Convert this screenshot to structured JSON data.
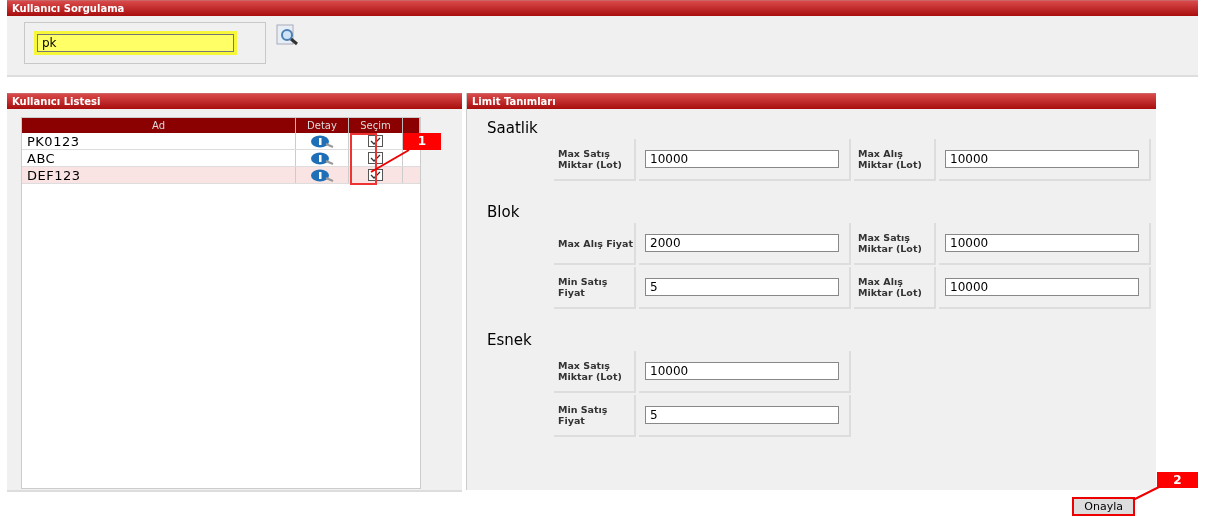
{
  "query_panel": {
    "title": "Kullanıcı Sorgulama",
    "search": {
      "value": "pk"
    }
  },
  "user_list": {
    "title": "Kullanıcı Listesi",
    "columns": [
      "Ad",
      "Detay",
      "Seçim"
    ],
    "rows": [
      {
        "name": "PK0123",
        "checked": true,
        "selected": false
      },
      {
        "name": "ABC",
        "checked": true,
        "selected": false
      },
      {
        "name": "DEF123",
        "checked": true,
        "selected": true
      }
    ]
  },
  "limits": {
    "title": "Limit Tanımları",
    "sections": [
      {
        "title": "Saatlik",
        "rows": [
          [
            {
              "label": "Max Satış Miktar (Lot)",
              "value": "10000"
            },
            {
              "label": "Max Alış Miktar (Lot)",
              "value": "10000"
            }
          ]
        ]
      },
      {
        "title": "Blok",
        "rows": [
          [
            {
              "label": "Max Alış Fiyat",
              "value": "2000"
            },
            {
              "label": "Max Satış Miktar (Lot)",
              "value": "10000"
            }
          ],
          [
            {
              "label": "Min Satış Fiyat",
              "value": "5"
            },
            {
              "label": "Max Alış Miktar (Lot)",
              "value": "10000"
            }
          ]
        ]
      },
      {
        "title": "Esnek",
        "rows": [
          [
            {
              "label": "Max Satış Miktar (Lot)",
              "value": "10000"
            }
          ],
          [
            {
              "label": "Min Satış Fiyat",
              "value": "5"
            }
          ]
        ]
      }
    ]
  },
  "confirm_button": "Onayla",
  "annotations": [
    {
      "label": "1"
    },
    {
      "label": "2"
    }
  ]
}
